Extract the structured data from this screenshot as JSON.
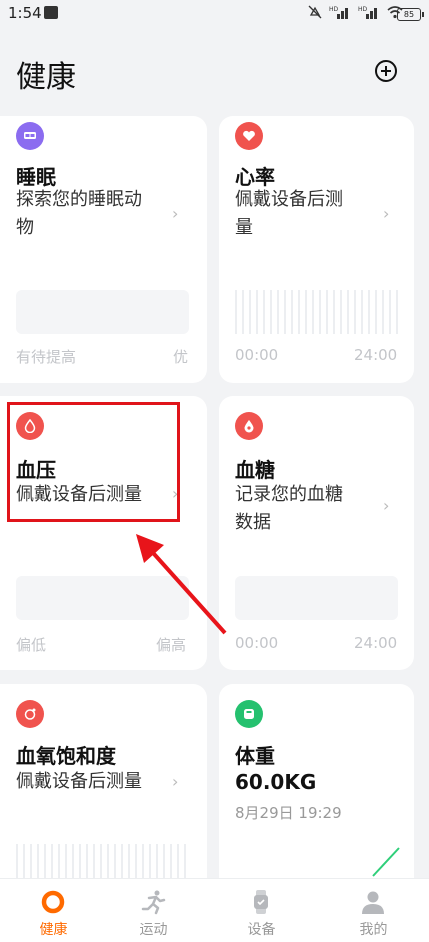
{
  "status_bar": {
    "time": "1:54",
    "battery": "85"
  },
  "header": {
    "title": "健康"
  },
  "cards": {
    "sleep": {
      "title": "睡眠",
      "subtitle_line1": "探索您的睡眠动",
      "subtitle_line2": "物",
      "left_foot": "有待提高",
      "right_foot": "优",
      "icon_color": "#8b6cf0"
    },
    "heart": {
      "title": "心率",
      "subtitle_line1": "佩戴设备后测",
      "subtitle_line2": "量",
      "left_foot": "00:00",
      "right_foot": "24:00",
      "icon_color": "#f0534e"
    },
    "blood_pressure": {
      "title": "血压",
      "subtitle": "佩戴设备后测量",
      "left_foot": "偏低",
      "right_foot": "偏高",
      "icon_color": "#f0534e"
    },
    "blood_sugar": {
      "title": "血糖",
      "subtitle_line1": "记录您的血糖",
      "subtitle_line2": "数据",
      "left_foot": "00:00",
      "right_foot": "24:00",
      "icon_color": "#f0534e"
    },
    "spo2": {
      "title": "血氧饱和度",
      "subtitle": "佩戴设备后测量",
      "icon_color": "#f0534e"
    },
    "weight": {
      "title": "体重",
      "value": "60.0KG",
      "timestamp": "8月29日 19:29",
      "icon_color": "#25c16f"
    }
  },
  "bottom_nav": [
    {
      "label": "健康",
      "active": true
    },
    {
      "label": "运动"
    },
    {
      "label": "设备"
    },
    {
      "label": "我的"
    }
  ]
}
